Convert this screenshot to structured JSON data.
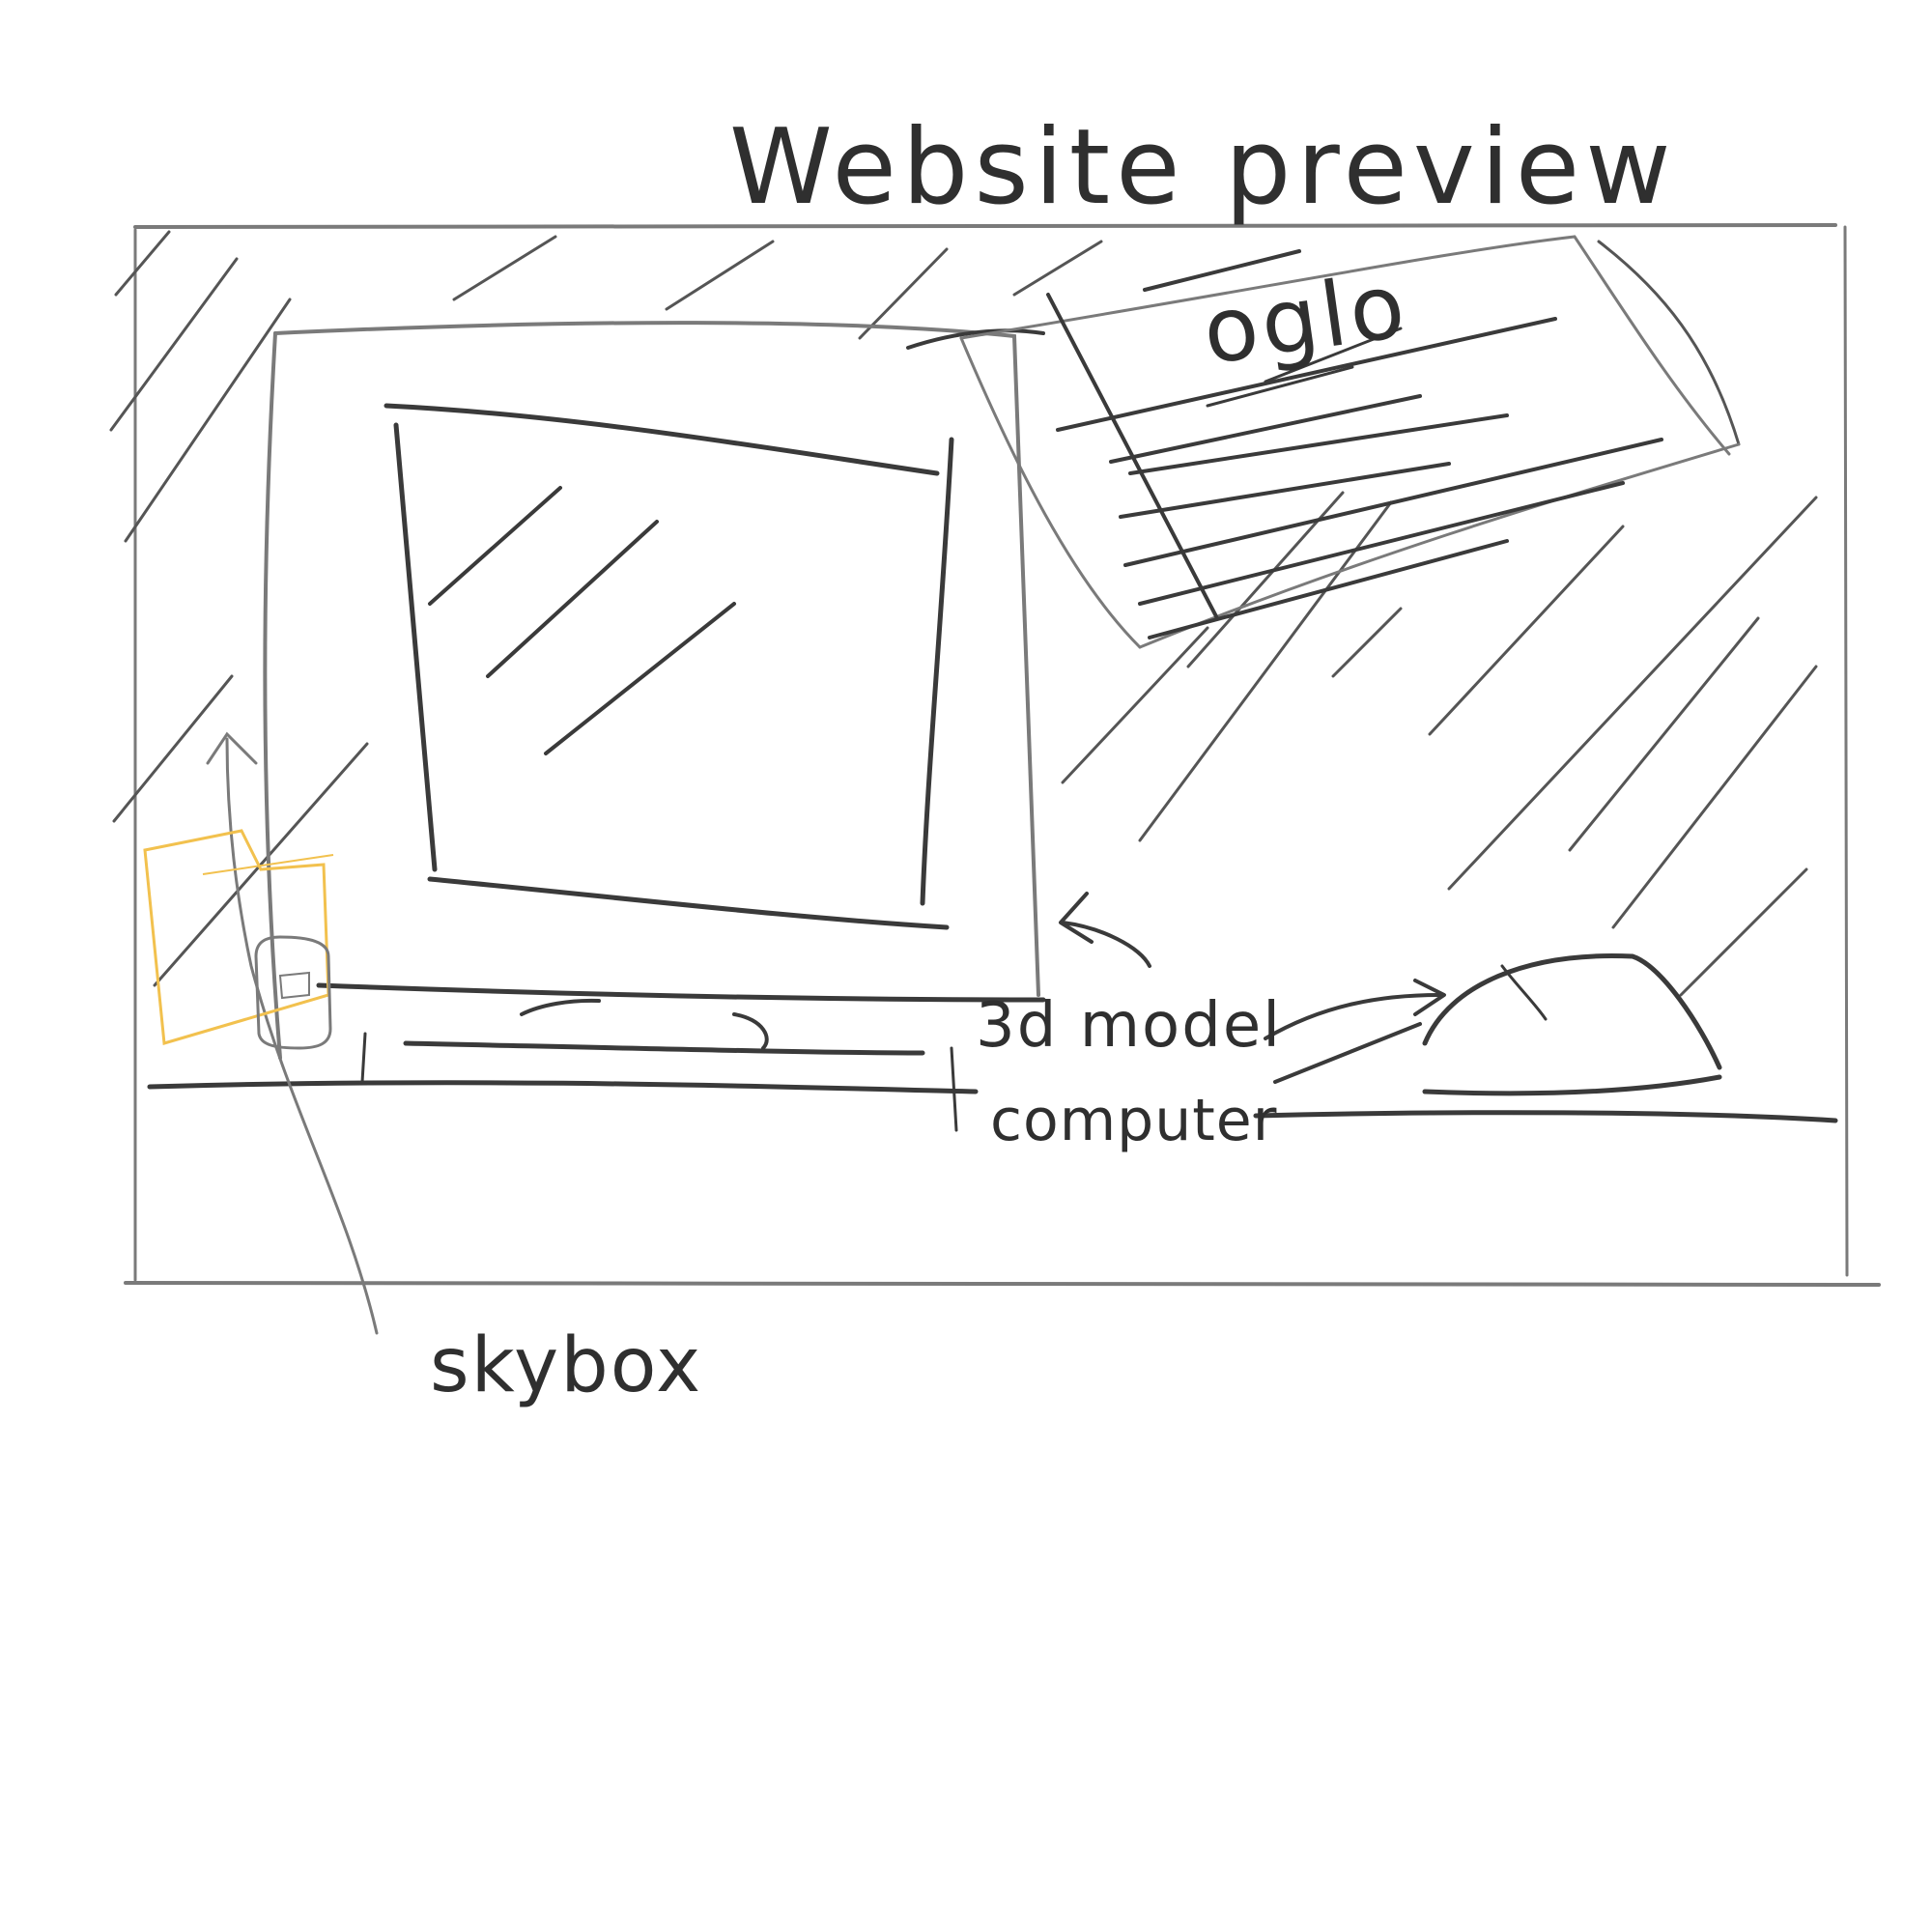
{
  "sketch": {
    "title": "Website preview",
    "logo_text": "oglo",
    "model_label_line1": "3d model",
    "model_label_line2": "computer",
    "skybox_label": "skybox"
  },
  "colors": {
    "ink": "#3a3a3a",
    "accent": "#f2c14e",
    "paper": "#ffffff"
  },
  "icons": {
    "frame": "preview-frame",
    "monitor": "computer-monitor-sketch",
    "mouse": "computer-mouse-sketch",
    "sign": "logo-sign-sketch",
    "folder": "folder-icon"
  }
}
